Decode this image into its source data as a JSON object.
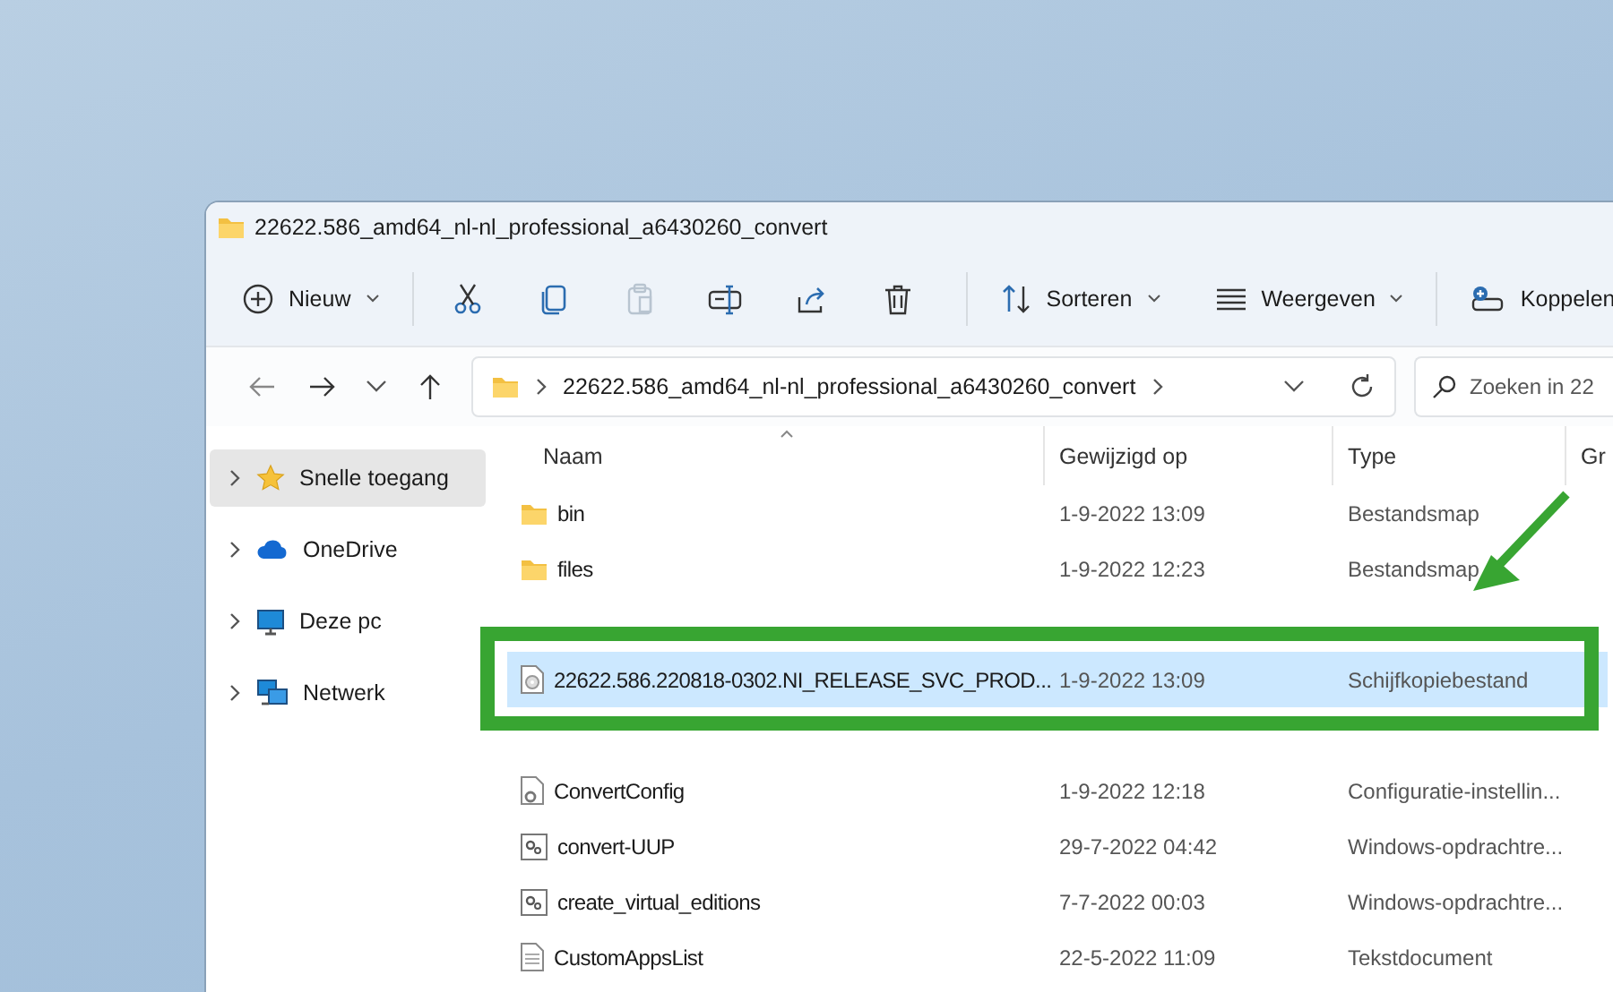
{
  "window": {
    "title": "22622.586_amd64_nl-nl_professional_a6430260_convert"
  },
  "toolbar": {
    "new_button": {
      "label": "Nieuw"
    },
    "actions": [
      {
        "disabled": false
      },
      {
        "disabled": false
      },
      {
        "disabled": true
      },
      {
        "disabled": false
      },
      {
        "disabled": false
      },
      {
        "disabled": false
      }
    ],
    "sort_button": {
      "label": "Sorteren"
    },
    "view_button": {
      "label": "Weergeven"
    },
    "connect_button": {
      "label": "Koppelen"
    }
  },
  "address_bar": {
    "path": "22622.586_amd64_nl-nl_professional_a6430260_convert",
    "search": {
      "placeholder": "Zoeken in 22"
    }
  },
  "sidebar": {
    "items": [
      {
        "label": "Snelle toegang",
        "selected": true
      },
      {
        "label": "OneDrive",
        "selected": false
      },
      {
        "label": "Deze pc",
        "selected": false
      },
      {
        "label": "Netwerk",
        "selected": false
      }
    ]
  },
  "file_list": {
    "columns": [
      "Naam",
      "Gewijzigd op",
      "Type",
      "Gr"
    ],
    "rows": [
      {
        "kind": "folder",
        "name": "bin",
        "modified": "1-9-2022 13:09",
        "type": "Bestandsmap",
        "selected": false
      },
      {
        "kind": "folder",
        "name": "files",
        "modified": "1-9-2022 12:23",
        "type": "Bestandsmap",
        "selected": false
      },
      {
        "kind": "covered",
        "selected": false
      },
      {
        "kind": "disc",
        "name": "22622.586.220818-0302.NI_RELEASE_SVC_PROD...",
        "modified": "1-9-2022 13:09",
        "type": "Schijfkopiebestand",
        "selected": true
      },
      {
        "kind": "covered",
        "selected": false
      },
      {
        "kind": "config",
        "name": "ConvertConfig",
        "modified": "1-9-2022 12:18",
        "type": "Configuratie-instellin...",
        "selected": false
      },
      {
        "kind": "script",
        "name": "convert-UUP",
        "modified": "29-7-2022 04:42",
        "type": "Windows-opdrachtre...",
        "selected": false
      },
      {
        "kind": "script",
        "name": "create_virtual_editions",
        "modified": "7-7-2022 00:03",
        "type": "Windows-opdrachtre...",
        "selected": false
      },
      {
        "kind": "text",
        "name": "CustomAppsList",
        "modified": "22-5-2022 11:09",
        "type": "Tekstdocument",
        "selected": false
      }
    ]
  }
}
